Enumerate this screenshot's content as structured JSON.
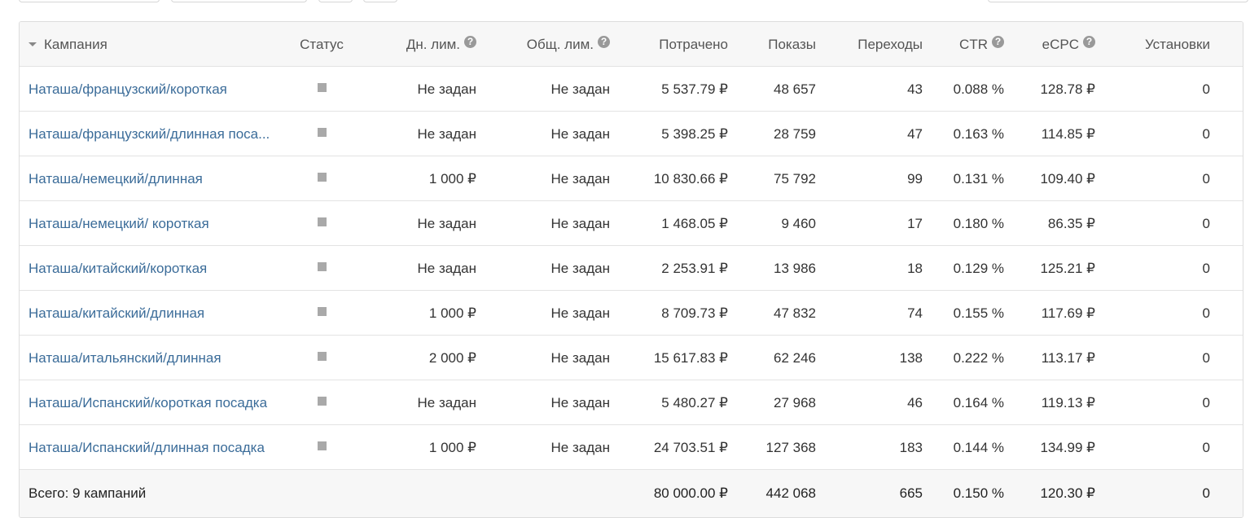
{
  "header": {
    "campaign": "Кампания",
    "status": "Статус",
    "day_limit": "Дн. лим.",
    "total_limit": "Общ. лим.",
    "spent": "Потрачено",
    "shows": "Показы",
    "clicks": "Переходы",
    "ctr": "CTR",
    "ecpc": "eCPC",
    "installs": "Установки",
    "help_glyph": "?"
  },
  "status_color": "#a9a9a9",
  "link_color": "#3b6c99",
  "rows": [
    {
      "name": "Наташа/французский/короткая",
      "day_limit": "Не задан",
      "total_limit": "Не задан",
      "spent": "5 537.79 ₽",
      "shows": "48 657",
      "clicks": "43",
      "ctr": "0.088 %",
      "ecpc": "128.78 ₽",
      "installs": "0"
    },
    {
      "name": "Наташа/французский/длинная поса...",
      "day_limit": "Не задан",
      "total_limit": "Не задан",
      "spent": "5 398.25 ₽",
      "shows": "28 759",
      "clicks": "47",
      "ctr": "0.163 %",
      "ecpc": "114.85 ₽",
      "installs": "0"
    },
    {
      "name": "Наташа/немецкий/длинная",
      "day_limit": "1 000 ₽",
      "total_limit": "Не задан",
      "spent": "10 830.66 ₽",
      "shows": "75 792",
      "clicks": "99",
      "ctr": "0.131 %",
      "ecpc": "109.40 ₽",
      "installs": "0"
    },
    {
      "name": "Наташа/немецкий/ короткая",
      "day_limit": "Не задан",
      "total_limit": "Не задан",
      "spent": "1 468.05 ₽",
      "shows": "9 460",
      "clicks": "17",
      "ctr": "0.180 %",
      "ecpc": "86.35 ₽",
      "installs": "0"
    },
    {
      "name": "Наташа/китайский/короткая",
      "day_limit": "Не задан",
      "total_limit": "Не задан",
      "spent": "2 253.91 ₽",
      "shows": "13 986",
      "clicks": "18",
      "ctr": "0.129 %",
      "ecpc": "125.21 ₽",
      "installs": "0"
    },
    {
      "name": "Наташа/китайский/длинная",
      "day_limit": "1 000 ₽",
      "total_limit": "Не задан",
      "spent": "8 709.73 ₽",
      "shows": "47 832",
      "clicks": "74",
      "ctr": "0.155 %",
      "ecpc": "117.69 ₽",
      "installs": "0"
    },
    {
      "name": "Наташа/итальянский/длинная",
      "day_limit": "2 000 ₽",
      "total_limit": "Не задан",
      "spent": "15 617.83 ₽",
      "shows": "62 246",
      "clicks": "138",
      "ctr": "0.222 %",
      "ecpc": "113.17 ₽",
      "installs": "0"
    },
    {
      "name": "Наташа/Испанский/короткая посадка",
      "day_limit": "Не задан",
      "total_limit": "Не задан",
      "spent": "5 480.27 ₽",
      "shows": "27 968",
      "clicks": "46",
      "ctr": "0.164 %",
      "ecpc": "119.13 ₽",
      "installs": "0"
    },
    {
      "name": "Наташа/Испанский/длинная посадка",
      "day_limit": "1 000 ₽",
      "total_limit": "Не задан",
      "spent": "24 703.51 ₽",
      "shows": "127 368",
      "clicks": "183",
      "ctr": "0.144 %",
      "ecpc": "134.99 ₽",
      "installs": "0"
    }
  ],
  "totals": {
    "label": "Всего: 9 кампаний",
    "spent": "80 000.00 ₽",
    "shows": "442 068",
    "clicks": "665",
    "ctr": "0.150 %",
    "ecpc": "120.30 ₽",
    "installs": "0"
  }
}
